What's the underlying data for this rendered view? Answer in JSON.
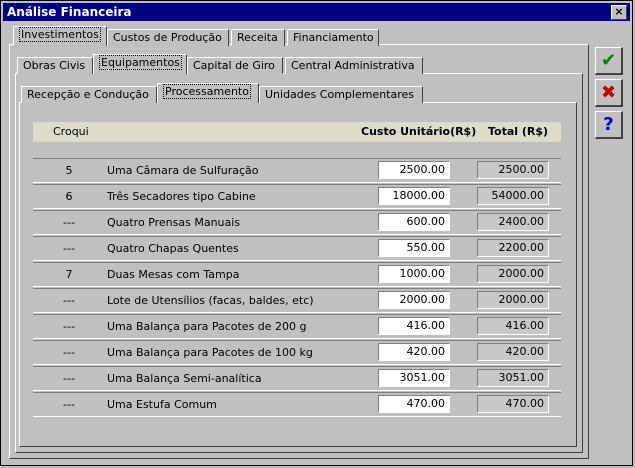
{
  "window": {
    "title": "Análise Financeira",
    "close_label": "×"
  },
  "tabs_level1": [
    "Investimentos",
    "Custos de Produção",
    "Receita",
    "Financiamento"
  ],
  "tabs_level2": [
    "Obras Civis",
    "Equipamentos",
    "Capital de Giro",
    "Central Administrativa"
  ],
  "tabs_level3": [
    "Recepção e Condução",
    "Processamento",
    "Unidades Complementares"
  ],
  "side_buttons": {
    "ok": "✔",
    "cancel": "✖",
    "help": "?"
  },
  "colors": {
    "ok": "#008000",
    "cancel": "#c00000",
    "help": "#0000c0",
    "title": "#000080"
  },
  "table": {
    "headers": {
      "croqui": "Croqui",
      "unit_cost": "Custo Unitário(R$)",
      "total": "Total (R$)"
    },
    "rows": [
      {
        "croqui": "5",
        "desc": "Uma Câmara de Sulfuração",
        "unit": "2500.00",
        "total": "2500.00"
      },
      {
        "croqui": "6",
        "desc": "Três Secadores tipo Cabine",
        "unit": "18000.00",
        "total": "54000.00"
      },
      {
        "croqui": "---",
        "desc": "Quatro Prensas Manuais",
        "unit": "600.00",
        "total": "2400.00"
      },
      {
        "croqui": "---",
        "desc": "Quatro Chapas Quentes",
        "unit": "550.00",
        "total": "2200.00"
      },
      {
        "croqui": "7",
        "desc": "Duas Mesas com Tampa",
        "unit": "1000.00",
        "total": "2000.00"
      },
      {
        "croqui": "---",
        "desc": "Lote de Utensílios (facas, baldes, etc)",
        "unit": "2000.00",
        "total": "2000.00"
      },
      {
        "croqui": "---",
        "desc": "Uma Balança para Pacotes de 200 g",
        "unit": "416.00",
        "total": "416.00"
      },
      {
        "croqui": "---",
        "desc": "Uma Balança para Pacotes de 100 kg",
        "unit": "420.00",
        "total": "420.00"
      },
      {
        "croqui": "---",
        "desc": "Uma Balança Semi-analítica",
        "unit": "3051.00",
        "total": "3051.00"
      },
      {
        "croqui": "---",
        "desc": "Uma Estufa Comum",
        "unit": "470.00",
        "total": "470.00"
      }
    ]
  }
}
